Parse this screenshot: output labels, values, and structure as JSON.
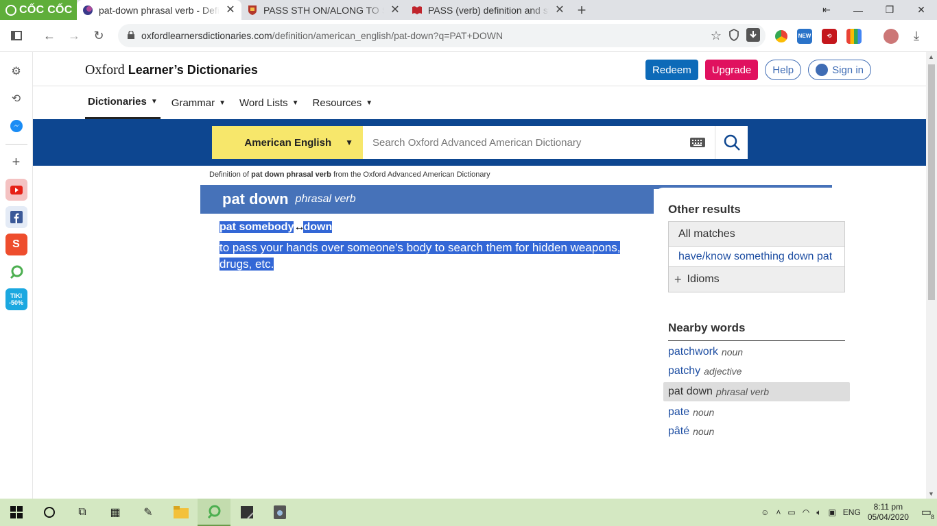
{
  "browser": {
    "brand": "CỐC CỐC",
    "tabs": [
      {
        "title": "pat-down phrasal verb - Defi",
        "active": true
      },
      {
        "title": "PASS STH ON/ALONG TO SB |",
        "active": false
      },
      {
        "title": "PASS (verb) definition and syr",
        "active": false
      }
    ],
    "url_host": "oxfordlearnersdictionaries.com",
    "url_path": "/definition/american_english/pat-down?q=PAT+DOWN"
  },
  "site": {
    "logo_plain": "Oxford",
    "logo_bold": "Learner’s Dictionaries",
    "buttons": {
      "redeem": "Redeem",
      "upgrade": "Upgrade",
      "help": "Help",
      "signin": "Sign in"
    },
    "nav": [
      "Dictionaries",
      "Grammar",
      "Word Lists",
      "Resources"
    ],
    "search": {
      "dictionary": "American English",
      "placeholder": "Search Oxford Advanced American Dictionary"
    }
  },
  "entry": {
    "definition_of_prefix": "Definition of",
    "definition_of_bold": "pat down phrasal verb",
    "definition_of_suffix": "from the Oxford Advanced American Dictionary",
    "headword": "pat down",
    "pos": "phrasal verb",
    "phrase_part1": "pat somebody",
    "phrase_part2": "down",
    "definition_line1": "to pass your hands over someone's body to search them for hidden weapons,",
    "definition_line2": "drugs, etc."
  },
  "sidebar_right": {
    "other_results_title": "Other results",
    "all_matches": "All matches",
    "match_link": "have/know something down pat",
    "idioms": "Idioms",
    "nearby_title": "Nearby words",
    "nearby": [
      {
        "word": "patchwork",
        "pos": "noun",
        "current": false
      },
      {
        "word": "patchy",
        "pos": "adjective",
        "current": false
      },
      {
        "word": "pat down",
        "pos": "phrasal verb",
        "current": true
      },
      {
        "word": "pate",
        "pos": "noun",
        "current": false
      },
      {
        "word": "pâté",
        "pos": "noun",
        "current": false
      }
    ]
  },
  "taskbar": {
    "language": "ENG",
    "time": "8:11 pm",
    "date": "05/04/2020",
    "notifications": "8"
  },
  "colors": {
    "banner": "#0d4690",
    "entry_head": "#4672b9",
    "selection": "#3367d6",
    "redeem": "#0d6ab8",
    "upgrade": "#e0115f",
    "dict_select": "#f7e76b"
  }
}
